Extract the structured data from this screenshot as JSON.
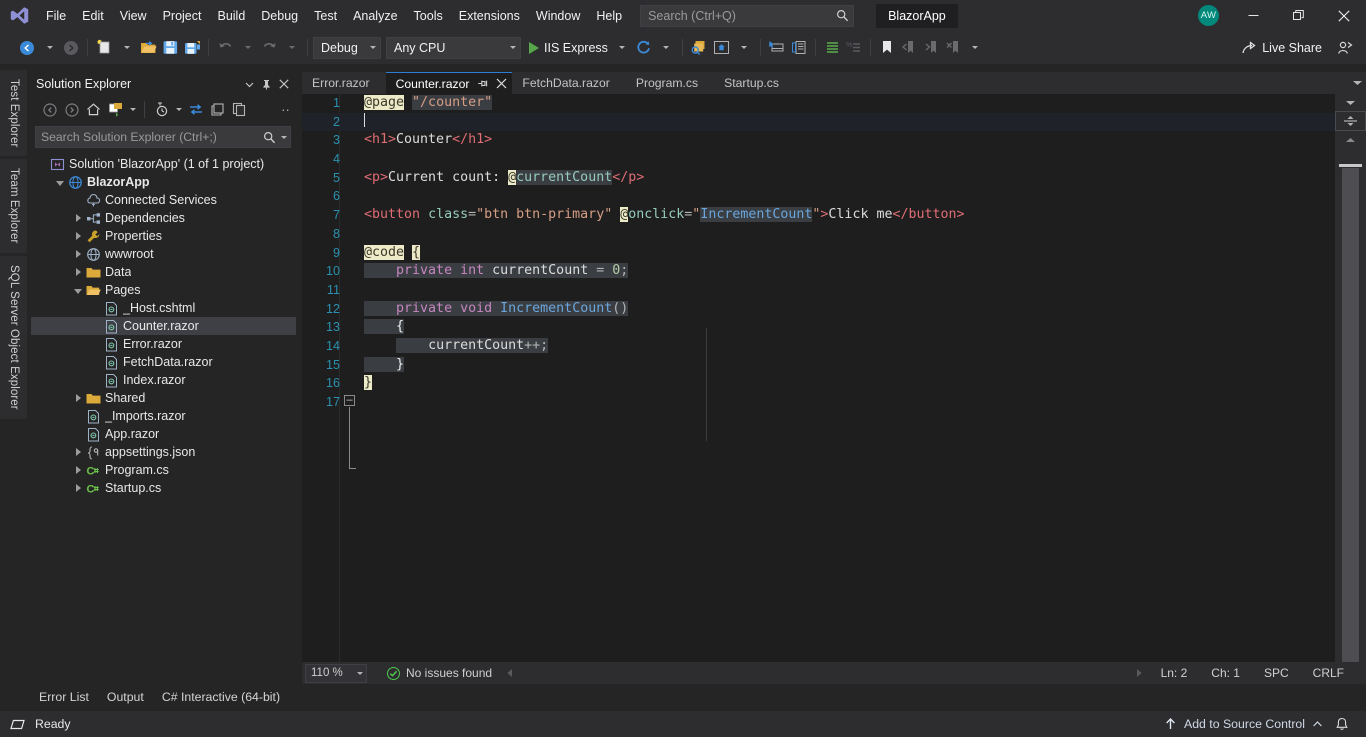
{
  "window": {
    "app_chip": "BlazorApp",
    "avatar_initials": "AW",
    "minimize": "minimize-icon",
    "restore": "restore-icon",
    "close": "close-icon"
  },
  "menu": {
    "items": [
      "File",
      "Edit",
      "View",
      "Project",
      "Build",
      "Debug",
      "Test",
      "Analyze",
      "Tools",
      "Extensions",
      "Window",
      "Help"
    ]
  },
  "search": {
    "placeholder": "Search (Ctrl+Q)"
  },
  "toolbar": {
    "config": "Debug",
    "platform": "Any CPU",
    "run_target": "IIS Express",
    "live_share": "Live Share"
  },
  "vertical_tabs": [
    "Test Explorer",
    "Team Explorer",
    "SQL Server Object Explorer"
  ],
  "solution_explorer": {
    "title": "Solution Explorer",
    "search_placeholder": "Search Solution Explorer (Ctrl+;)",
    "tree": [
      {
        "label": "Solution 'BlazorApp' (1 of 1 project)",
        "indent": 0,
        "icon": "solution-icon",
        "expander": "none",
        "bold": false,
        "selected": false
      },
      {
        "label": "BlazorApp",
        "indent": 1,
        "icon": "project-web-icon",
        "expander": "open",
        "bold": true,
        "selected": false
      },
      {
        "label": "Connected Services",
        "indent": 2,
        "icon": "connected-services-icon",
        "expander": "none",
        "bold": false,
        "selected": false
      },
      {
        "label": "Dependencies",
        "indent": 2,
        "icon": "dependencies-icon",
        "expander": "closed",
        "bold": false,
        "selected": false
      },
      {
        "label": "Properties",
        "indent": 2,
        "icon": "properties-wrench-icon",
        "expander": "closed",
        "bold": false,
        "selected": false
      },
      {
        "label": "wwwroot",
        "indent": 2,
        "icon": "globe-icon",
        "expander": "closed",
        "bold": false,
        "selected": false
      },
      {
        "label": "Data",
        "indent": 2,
        "icon": "folder-icon",
        "expander": "closed",
        "bold": false,
        "selected": false
      },
      {
        "label": "Pages",
        "indent": 2,
        "icon": "folder-open-icon",
        "expander": "open",
        "bold": false,
        "selected": false
      },
      {
        "label": "_Host.cshtml",
        "indent": 3,
        "icon": "razor-file-icon",
        "expander": "none",
        "bold": false,
        "selected": false
      },
      {
        "label": "Counter.razor",
        "indent": 3,
        "icon": "razor-file-icon",
        "expander": "none",
        "bold": false,
        "selected": true
      },
      {
        "label": "Error.razor",
        "indent": 3,
        "icon": "razor-file-icon",
        "expander": "none",
        "bold": false,
        "selected": false
      },
      {
        "label": "FetchData.razor",
        "indent": 3,
        "icon": "razor-file-icon",
        "expander": "none",
        "bold": false,
        "selected": false
      },
      {
        "label": "Index.razor",
        "indent": 3,
        "icon": "razor-file-icon",
        "expander": "none",
        "bold": false,
        "selected": false
      },
      {
        "label": "Shared",
        "indent": 2,
        "icon": "folder-icon",
        "expander": "closed",
        "bold": false,
        "selected": false
      },
      {
        "label": "_Imports.razor",
        "indent": 2,
        "icon": "razor-file-icon",
        "expander": "none",
        "bold": false,
        "selected": false
      },
      {
        "label": "App.razor",
        "indent": 2,
        "icon": "razor-file-icon",
        "expander": "none",
        "bold": false,
        "selected": false
      },
      {
        "label": "appsettings.json",
        "indent": 2,
        "icon": "json-file-icon",
        "expander": "closed",
        "bold": false,
        "selected": false
      },
      {
        "label": "Program.cs",
        "indent": 2,
        "icon": "csharp-file-icon",
        "expander": "closed",
        "bold": false,
        "selected": false
      },
      {
        "label": "Startup.cs",
        "indent": 2,
        "icon": "csharp-file-icon",
        "expander": "closed",
        "bold": false,
        "selected": false
      }
    ]
  },
  "editor": {
    "tabs": [
      {
        "label": "Error.razor",
        "active": false
      },
      {
        "label": "Counter.razor",
        "active": true
      },
      {
        "label": "FetchData.razor",
        "active": false
      },
      {
        "label": "Program.cs",
        "active": false
      },
      {
        "label": "Startup.cs",
        "active": false
      }
    ],
    "lines": [
      {
        "n": 1,
        "text": "@page \"/counter\""
      },
      {
        "n": 2,
        "text": ""
      },
      {
        "n": 3,
        "text": "<h1>Counter</h1>"
      },
      {
        "n": 4,
        "text": ""
      },
      {
        "n": 5,
        "text": "<p>Current count: @currentCount</p>"
      },
      {
        "n": 6,
        "text": ""
      },
      {
        "n": 7,
        "text": "<button class=\"btn btn-primary\" @onclick=\"IncrementCount\">Click me</button>"
      },
      {
        "n": 8,
        "text": ""
      },
      {
        "n": 9,
        "text": "@code {"
      },
      {
        "n": 10,
        "text": "    private int currentCount = 0;"
      },
      {
        "n": 11,
        "text": ""
      },
      {
        "n": 12,
        "text": "    private void IncrementCount()"
      },
      {
        "n": 13,
        "text": "    {"
      },
      {
        "n": 14,
        "text": "        currentCount++;"
      },
      {
        "n": 15,
        "text": "    }"
      },
      {
        "n": 16,
        "text": "}"
      },
      {
        "n": 17,
        "text": ""
      }
    ],
    "status": {
      "zoom": "110 %",
      "issues": "No issues found",
      "line": "Ln: 2",
      "col": "Ch: 1",
      "spaces": "SPC",
      "eol": "CRLF"
    }
  },
  "dock": {
    "tabs": [
      "Error List",
      "Output",
      "C# Interactive (64-bit)"
    ]
  },
  "statusbar": {
    "ready": "Ready",
    "source_control": "Add to Source Control"
  }
}
